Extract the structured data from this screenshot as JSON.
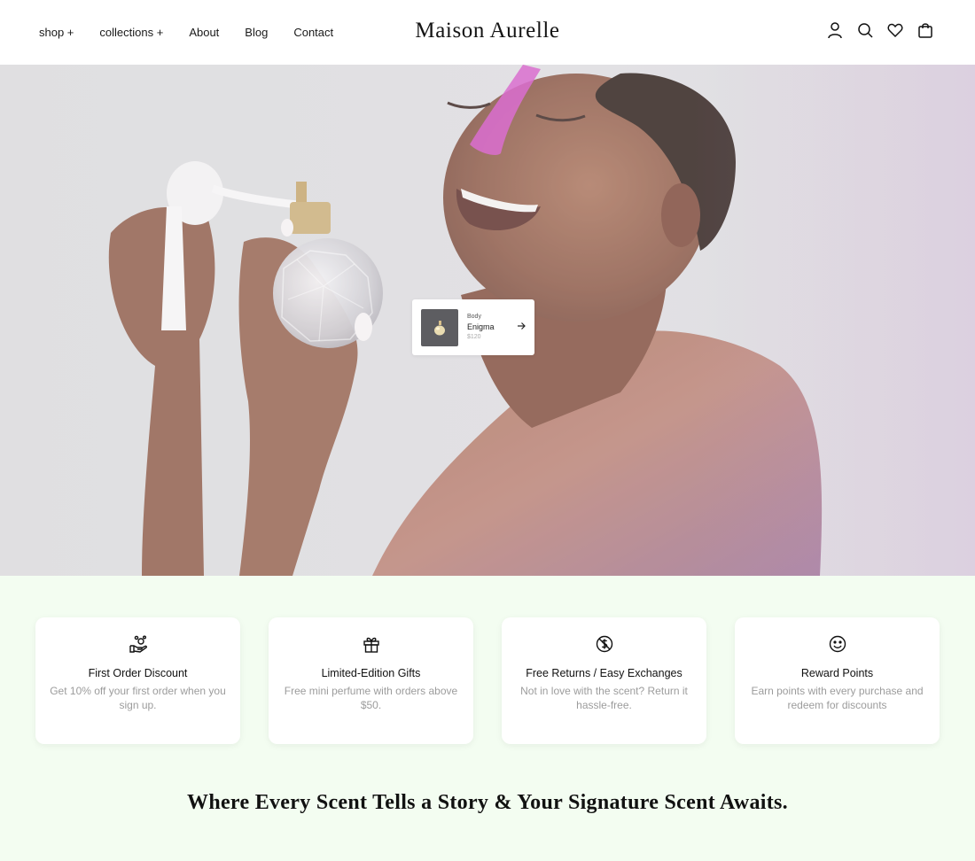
{
  "header": {
    "nav": [
      "shop +",
      "collections +",
      "About",
      "Blog",
      "Contact"
    ],
    "brand": "Maison Aurelle",
    "icons": [
      "user-icon",
      "search-icon",
      "heart-icon",
      "bag-icon"
    ]
  },
  "hero": {
    "product": {
      "category": "Body",
      "name": "Enigma",
      "price": "$120",
      "arrow_icon": "arrow-right-icon"
    }
  },
  "features": [
    {
      "icon": "hand-coin-icon",
      "title": "First Order Discount",
      "desc": "Get 10% off your first order when you sign up."
    },
    {
      "icon": "gift-icon",
      "title": "Limited-Edition Gifts",
      "desc": "Free mini perfume with orders above $50."
    },
    {
      "icon": "return-coin-icon",
      "title": "Free Returns / Easy Exchanges",
      "desc": "Not in love with the scent? Return it hassle-free."
    },
    {
      "icon": "smile-icon",
      "title": "Reward Points",
      "desc": "Earn points with every purchase and redeem for discounts"
    }
  ],
  "tagline": "Where Every Scent Tells a Story & Your Signature Scent Awaits.",
  "colors": {
    "features_bg": "#f3fdf1",
    "header_bg": "#ffffff",
    "accent_pink": "#d24fc6"
  }
}
